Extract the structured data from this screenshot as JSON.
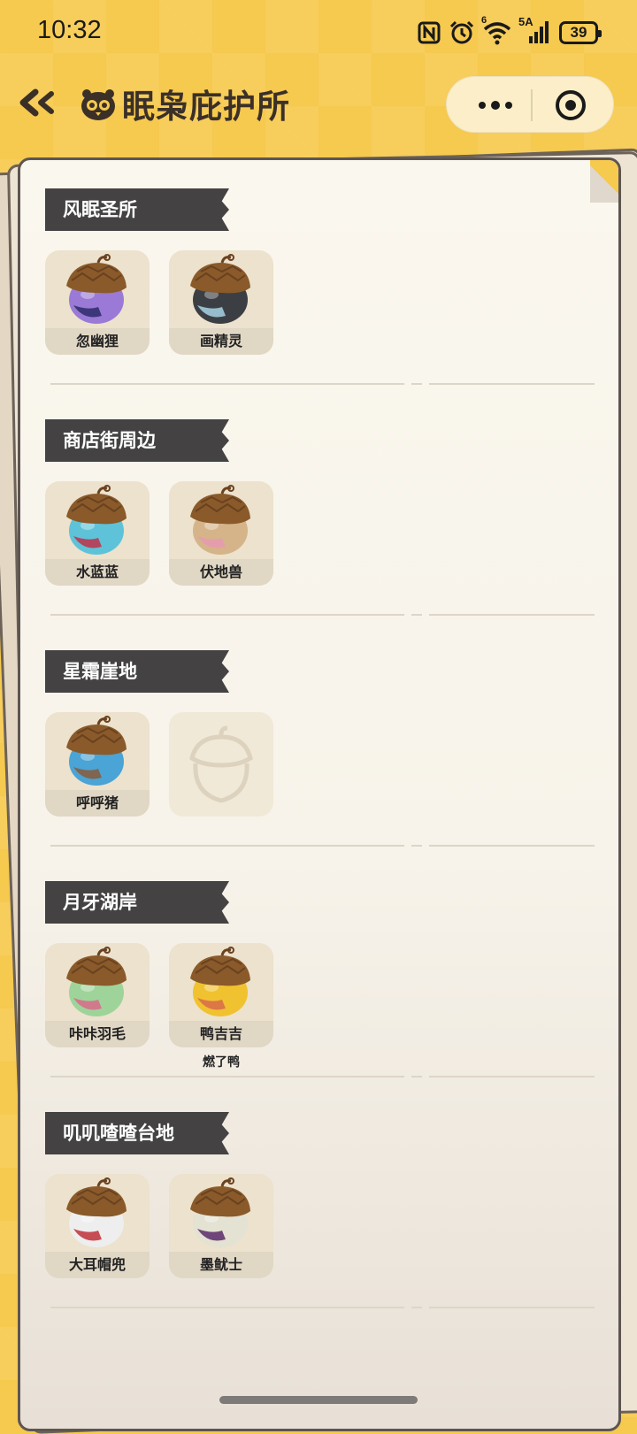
{
  "status_bar": {
    "time": "10:32",
    "network_label": "5A",
    "wifi_label": "6",
    "battery": "39",
    "icons": [
      "nfc-icon",
      "alarm-icon",
      "wifi-icon",
      "signal-icon",
      "battery-icon"
    ]
  },
  "header": {
    "title": "眠枭庇护所",
    "back_icon": "double-chevron-left-icon",
    "more_icon": "more-dots-icon",
    "close_icon": "target-circle-icon"
  },
  "sections": [
    {
      "title": "风眠圣所",
      "items": [
        {
          "label": "忽幽狸",
          "color": "#9a7ad6",
          "accent": "#2d2a6a"
        },
        {
          "label": "画精灵",
          "color": "#3b3f44",
          "accent": "#a8d4e4"
        }
      ]
    },
    {
      "title": "商店街周边",
      "items": [
        {
          "label": "水蓝蓝",
          "color": "#5ec3d8",
          "accent": "#c0304a"
        },
        {
          "label": "伏地兽",
          "color": "#d6b48a",
          "accent": "#e69ab0"
        }
      ]
    },
    {
      "title": "星霜崖地",
      "items": [
        {
          "label": "呼呼猪",
          "color": "#4aa4d6",
          "accent": "#8a5a3a"
        }
      ]
    },
    {
      "title": "月牙湖岸",
      "items": [
        {
          "label": "咔咔羽毛",
          "color": "#9ed49a",
          "accent": "#d86a8a"
        },
        {
          "label": "鸭吉吉",
          "color": "#f0c230",
          "accent": "#d86a4a",
          "sub": "燃了鸭"
        }
      ]
    },
    {
      "title": "叽叽喳喳台地",
      "items": [
        {
          "label": "大耳帽兜",
          "color": "#eeeeee",
          "accent": "#c0303a"
        },
        {
          "label": "墨鱿士",
          "color": "#e4e2d2",
          "accent": "#5a2a6a"
        }
      ]
    }
  ]
}
